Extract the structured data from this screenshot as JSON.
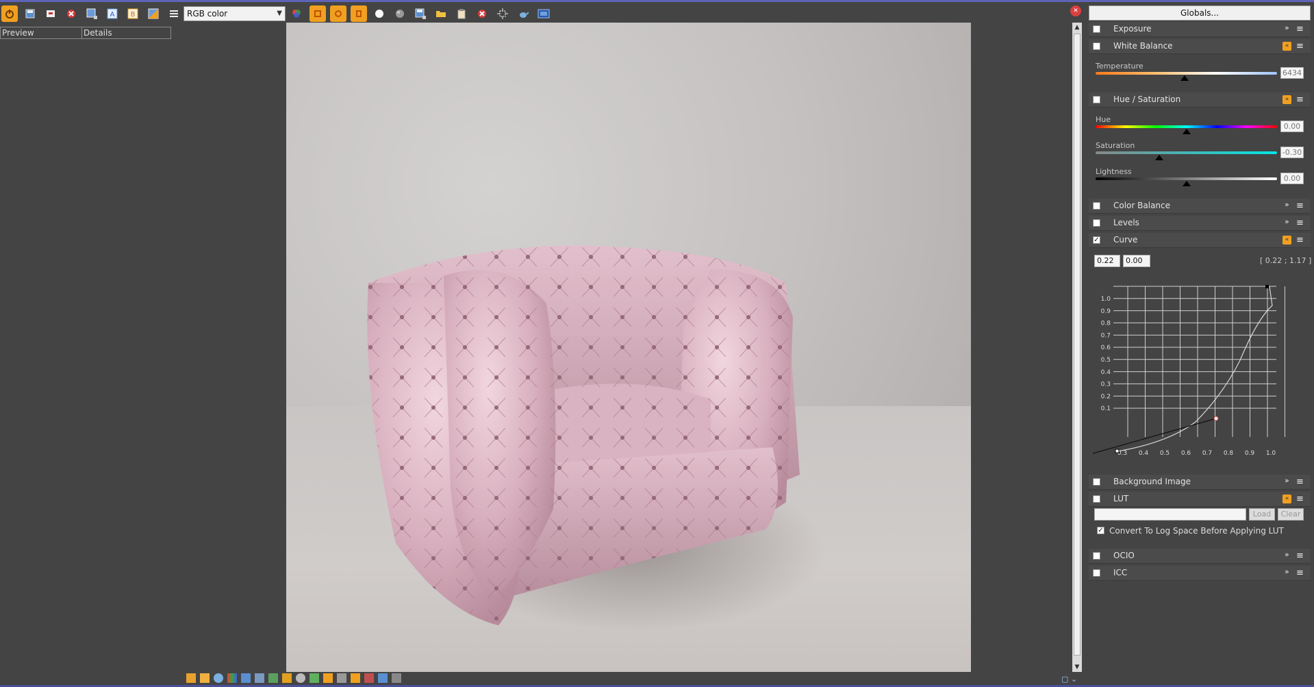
{
  "toolbar": {
    "channel_select": "RGB color",
    "icons": [
      "power-icon",
      "save-icon",
      "copy-icon",
      "clear-icon",
      "region-icon",
      "a-icon",
      "b-icon",
      "ab-compare-icon",
      "menu-icon",
      "color-corrections-icon",
      "track-mouse-icon",
      "link-icon",
      "render-icon",
      "white-circle-icon",
      "gray-circle-icon",
      "save-image-icon",
      "open-folder-icon",
      "clipboard-icon",
      "stop-icon",
      "region-render-icon",
      "teapot-icon",
      "film-icon"
    ]
  },
  "left_tabs": [
    "Preview",
    "Details"
  ],
  "panel": {
    "globals_label": "Globals...",
    "sections": {
      "exposure": "Exposure",
      "white_balance": "White Balance",
      "hue_saturation": "Hue / Saturation",
      "color_balance": "Color Balance",
      "levels": "Levels",
      "curve": "Curve",
      "background_image": "Background Image",
      "lut": "LUT",
      "ocio": "OCIO",
      "icc": "ICC"
    },
    "white_balance": {
      "temperature_label": "Temperature",
      "temperature_value": "6434",
      "temperature_fraction": 0.49
    },
    "hue_saturation": {
      "hue_label": "Hue",
      "hue_value": "0.00",
      "hue_fraction": 0.5,
      "saturation_label": "Saturation",
      "saturation_value": "-0.30",
      "saturation_fraction": 0.35,
      "lightness_label": "Lightness",
      "lightness_value": "0.00",
      "lightness_fraction": 0.5
    },
    "curve": {
      "x_value": "0.22",
      "y_value": "0.00",
      "coord_readout": "[ 0.22 ; 1.17 ]",
      "y_ticks": [
        "1.0",
        "0.9",
        "0.8",
        "0.7",
        "0.6",
        "0.5",
        "0.4",
        "0.3",
        "0.2",
        "0.1"
      ],
      "x_ticks": [
        "0.3",
        "0.4",
        "0.5",
        "0.6",
        "0.7",
        "0.8",
        "0.9",
        "1.0"
      ]
    },
    "lut": {
      "load_label": "Load",
      "clear_label": "Clear",
      "log_space_label": "Convert To Log Space Before Applying LUT"
    },
    "checks": {
      "curve_enabled": "✓",
      "log_space": "✓"
    }
  },
  "colors": {
    "accent": "#f0a020",
    "panel_bg": "#444444"
  }
}
